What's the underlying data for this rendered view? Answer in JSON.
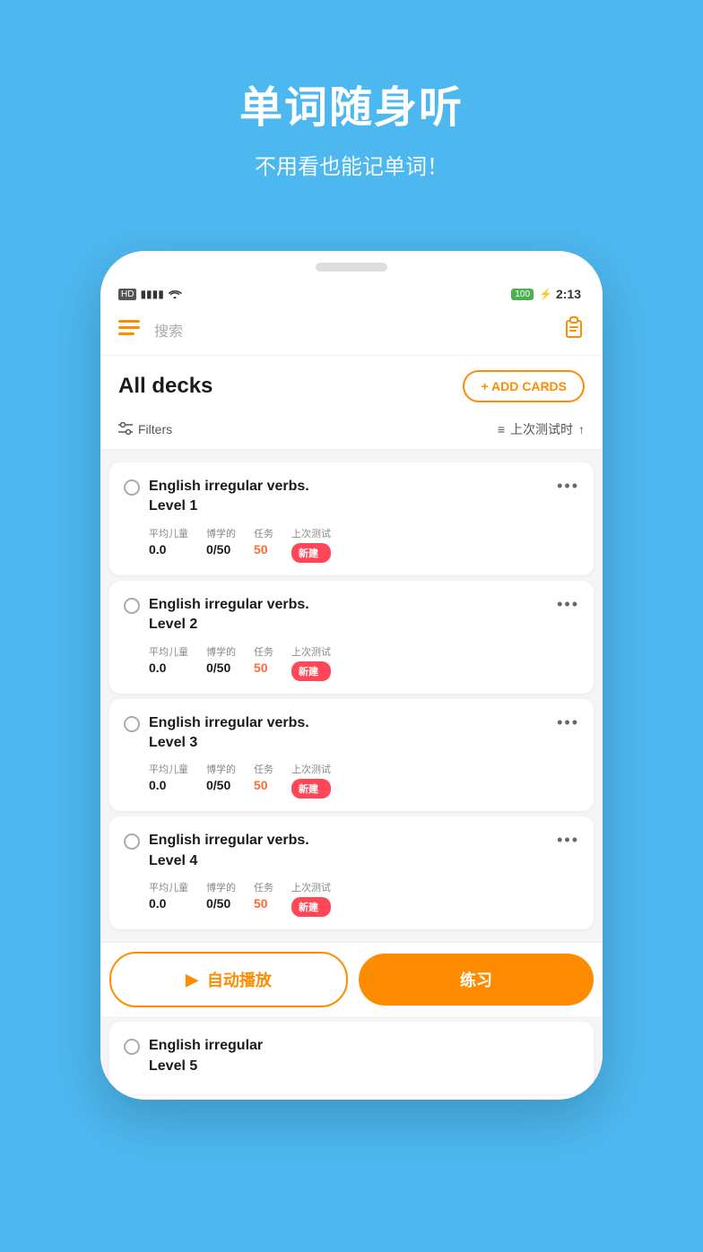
{
  "background_color": "#4db8f0",
  "hero": {
    "title": "单词随身听",
    "subtitle": "不用看也能记单词！"
  },
  "status_bar": {
    "left": "HD 4G",
    "battery": "100",
    "time": "2:13"
  },
  "nav": {
    "search_placeholder": "搜索",
    "hamburger": "☰",
    "clipboard": "📋"
  },
  "decks_header": {
    "title": "All decks",
    "add_button": "+ ADD CARDS"
  },
  "filters": {
    "left_label": "Filters",
    "right_label": "上次测试时",
    "sort_arrow": "↑"
  },
  "decks": [
    {
      "name_line1": "English irregular verbs.",
      "name_line2": "Level 1",
      "stat_avg_label": "平均儿童",
      "stat_avg_value": "0.0",
      "stat_learned_label": "博学的",
      "stat_learned_value": "0/50",
      "stat_task_label": "任务",
      "stat_task_value": "50",
      "stat_last_label": "上次测试",
      "stat_last_value": "新建"
    },
    {
      "name_line1": "English irregular verbs.",
      "name_line2": "Level 2",
      "stat_avg_label": "平均儿童",
      "stat_avg_value": "0.0",
      "stat_learned_label": "博学的",
      "stat_learned_value": "0/50",
      "stat_task_label": "任务",
      "stat_task_value": "50",
      "stat_last_label": "上次测试",
      "stat_last_value": "新建"
    },
    {
      "name_line1": "English irregular verbs.",
      "name_line2": "Level 3",
      "stat_avg_label": "平均儿童",
      "stat_avg_value": "0.0",
      "stat_learned_label": "博学的",
      "stat_learned_value": "0/50",
      "stat_task_label": "任务",
      "stat_task_value": "50",
      "stat_last_label": "上次测试",
      "stat_last_value": "新建"
    },
    {
      "name_line1": "English irregular verbs.",
      "name_line2": "Level 4",
      "stat_avg_label": "平均儿童",
      "stat_avg_value": "0.0",
      "stat_learned_label": "博学的",
      "stat_learned_value": "0/50",
      "stat_task_label": "任务",
      "stat_task_value": "50",
      "stat_last_label": "上次测试",
      "stat_last_value": "新建"
    }
  ],
  "partial_deck": {
    "name_line1": "English irregular",
    "name_line2": "Level 5"
  },
  "bottom_buttons": {
    "auto_play": "自动播放",
    "practice": "练习"
  }
}
